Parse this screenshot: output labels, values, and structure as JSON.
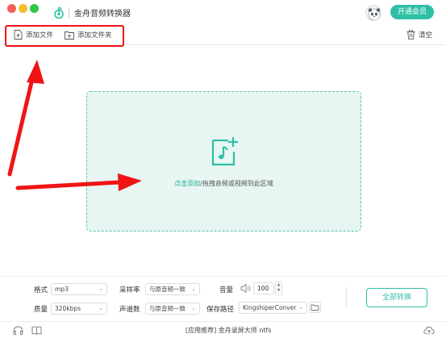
{
  "window": {
    "title": "金舟音频转换器",
    "vip_button": "开通会员",
    "accent": "#2fbfa5"
  },
  "toolbar": {
    "add_file": "添加文件",
    "add_folder": "添加文件夹",
    "clear": "清空",
    "icons": [
      "add-file-icon",
      "add-folder-icon",
      "trash-icon"
    ]
  },
  "dropzone": {
    "link_text": "点击添加",
    "hint_text": "/拖拽音频或视频到此区域",
    "icon": "add-music-file-icon"
  },
  "settings": {
    "format_label": "格式",
    "format_value": "mp3",
    "quality_label": "质量",
    "quality_value": "320kbps",
    "samplerate_label": "采样率",
    "samplerate_value": "与原音频一致",
    "channels_label": "声道数",
    "channels_value": "与原音频一致",
    "volume_label": "音量",
    "volume_value": "100",
    "savepath_label": "保存路径",
    "savepath_value": "KingshiperConver",
    "convert_all": "全部转换"
  },
  "footer": {
    "text": "[应用推荐]  金舟录屏大师  ntfs",
    "icons": [
      "headphones-icon",
      "book-icon",
      "cloud-upload-icon"
    ]
  },
  "annotation_color": "#f01414"
}
